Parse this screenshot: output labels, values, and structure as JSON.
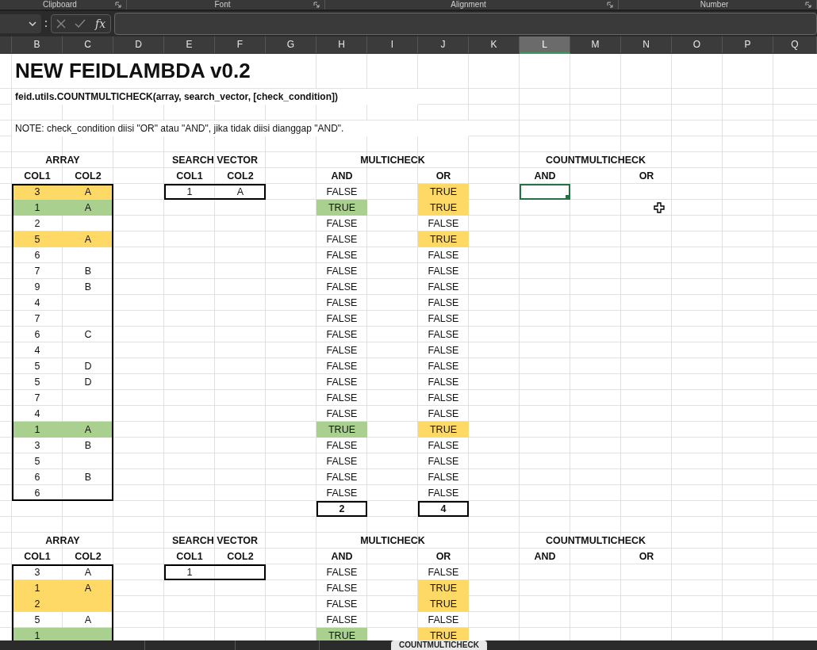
{
  "ribbon_groups": [
    "Clipboard",
    "Font",
    "Alignment",
    "Number"
  ],
  "formula_bar": {
    "function_label": "fx"
  },
  "columns": [
    {
      "letter": "B",
      "selected": false
    },
    {
      "letter": "C",
      "selected": false
    },
    {
      "letter": "D",
      "selected": false
    },
    {
      "letter": "E",
      "selected": false
    },
    {
      "letter": "F",
      "selected": false
    },
    {
      "letter": "G",
      "selected": false
    },
    {
      "letter": "H",
      "selected": false
    },
    {
      "letter": "I",
      "selected": false
    },
    {
      "letter": "J",
      "selected": false
    },
    {
      "letter": "K",
      "selected": false
    },
    {
      "letter": "L",
      "selected": true
    },
    {
      "letter": "M",
      "selected": false
    },
    {
      "letter": "N",
      "selected": false
    },
    {
      "letter": "O",
      "selected": false
    },
    {
      "letter": "P",
      "selected": false
    },
    {
      "letter": "Q",
      "selected": false
    }
  ],
  "title": "NEW FEIDLAMBDA v0.2",
  "signature": "feid.utils.COUNTMULTICHECK(array, search_vector, [check_condition])",
  "note": "NOTE: check_condition diisi \"OR\" atau \"AND\", jika tidak diisi dianggap \"AND\".",
  "blocks": [
    {
      "array": {
        "title": "ARRAY",
        "headers": [
          "COL1",
          "COL2"
        ],
        "rows": [
          {
            "col1": "3",
            "col2": "A",
            "color": "#ffd966"
          },
          {
            "col1": "1",
            "col2": "A",
            "color": "#a9d08e"
          },
          {
            "col1": "2"
          },
          {
            "col1": "5",
            "col2": "A",
            "color": "#ffd966"
          },
          {
            "col1": "6"
          },
          {
            "col1": "7",
            "col2": "B"
          },
          {
            "col1": "9",
            "col2": "B"
          },
          {
            "col1": "4"
          },
          {
            "col1": "7"
          },
          {
            "col1": "6",
            "col2": "C"
          },
          {
            "col1": "4"
          },
          {
            "col1": "5",
            "col2": "D"
          },
          {
            "col1": "5",
            "col2": "D"
          },
          {
            "col1": "7"
          },
          {
            "col1": "4"
          },
          {
            "col1": "1",
            "col2": "A",
            "color": "#a9d08e"
          },
          {
            "col1": "3",
            "col2": "B"
          },
          {
            "col1": "5"
          },
          {
            "col1": "6",
            "col2": "B"
          },
          {
            "col1": "6"
          }
        ]
      },
      "search_vector": {
        "title": "SEARCH VECTOR",
        "headers": [
          "COL1",
          "COL2"
        ],
        "values": [
          "1",
          "A"
        ]
      },
      "multicheck": {
        "title": "MULTICHECK",
        "headers": [
          "AND",
          "OR"
        ],
        "rows": [
          {
            "and": {
              "text": "FALSE",
              "highlighted": false
            },
            "or": {
              "text": "TRUE",
              "highlighted": true
            }
          },
          {
            "and": {
              "text": "TRUE",
              "highlighted": true
            },
            "or": {
              "text": "TRUE",
              "highlighted": true
            }
          },
          {
            "and": {
              "text": "FALSE",
              "highlighted": false
            },
            "or": {
              "text": "FALSE",
              "highlighted": false
            }
          },
          {
            "and": {
              "text": "FALSE",
              "highlighted": false
            },
            "or": {
              "text": "TRUE",
              "highlighted": true
            }
          },
          {
            "and": {
              "text": "FALSE",
              "highlighted": false
            },
            "or": {
              "text": "FALSE",
              "highlighted": false
            }
          },
          {
            "and": {
              "text": "FALSE",
              "highlighted": false
            },
            "or": {
              "text": "FALSE",
              "highlighted": false
            }
          },
          {
            "and": {
              "text": "FALSE",
              "highlighted": false
            },
            "or": {
              "text": "FALSE",
              "highlighted": false
            }
          },
          {
            "and": {
              "text": "FALSE",
              "highlighted": false
            },
            "or": {
              "text": "FALSE",
              "highlighted": false
            }
          },
          {
            "and": {
              "text": "FALSE",
              "highlighted": false
            },
            "or": {
              "text": "FALSE",
              "highlighted": false
            }
          },
          {
            "and": {
              "text": "FALSE",
              "highlighted": false
            },
            "or": {
              "text": "FALSE",
              "highlighted": false
            }
          },
          {
            "and": {
              "text": "FALSE",
              "highlighted": false
            },
            "or": {
              "text": "FALSE",
              "highlighted": false
            }
          },
          {
            "and": {
              "text": "FALSE",
              "highlighted": false
            },
            "or": {
              "text": "FALSE",
              "highlighted": false
            }
          },
          {
            "and": {
              "text": "FALSE",
              "highlighted": false
            },
            "or": {
              "text": "FALSE",
              "highlighted": false
            }
          },
          {
            "and": {
              "text": "FALSE",
              "highlighted": false
            },
            "or": {
              "text": "FALSE",
              "highlighted": false
            }
          },
          {
            "and": {
              "text": "FALSE",
              "highlighted": false
            },
            "or": {
              "text": "FALSE",
              "highlighted": false
            }
          },
          {
            "and": {
              "text": "TRUE",
              "highlighted": true
            },
            "or": {
              "text": "TRUE",
              "highlighted": true
            }
          },
          {
            "and": {
              "text": "FALSE",
              "highlighted": false
            },
            "or": {
              "text": "FALSE",
              "highlighted": false
            }
          },
          {
            "and": {
              "text": "FALSE",
              "highlighted": false
            },
            "or": {
              "text": "FALSE",
              "highlighted": false
            }
          },
          {
            "and": {
              "text": "FALSE",
              "highlighted": false
            },
            "or": {
              "text": "FALSE",
              "highlighted": false
            }
          },
          {
            "and": {
              "text": "FALSE",
              "highlighted": false
            },
            "or": {
              "text": "FALSE",
              "highlighted": false
            }
          }
        ],
        "totals": [
          "2",
          "4"
        ]
      },
      "countmulticheck": {
        "title": "COUNTMULTICHECK",
        "headers": [
          "AND",
          "OR"
        ],
        "active_cell": true
      }
    },
    {
      "array": {
        "title": "ARRAY",
        "headers": [
          "COL1",
          "COL2"
        ],
        "rows": [
          {
            "col1": "3",
            "col2": "A"
          },
          {
            "col1": "1",
            "col2": "A",
            "color": "#ffd966"
          },
          {
            "col1": "2",
            "color": "#ffd966"
          },
          {
            "col1": "5",
            "col2": "A"
          },
          {
            "col1": "1",
            "color": "#a9d08e"
          }
        ]
      },
      "search_vector": {
        "title": "SEARCH VECTOR",
        "headers": [
          "COL1",
          "COL2"
        ],
        "values": [
          "1"
        ]
      },
      "multicheck": {
        "title": "MULTICHECK",
        "headers": [
          "AND",
          "OR"
        ],
        "rows": [
          {
            "and": {
              "text": "FALSE",
              "highlighted": false
            },
            "or": {
              "text": "FALSE",
              "highlighted": false
            }
          },
          {
            "and": {
              "text": "FALSE",
              "highlighted": false
            },
            "or": {
              "text": "TRUE",
              "highlighted": true
            }
          },
          {
            "and": {
              "text": "FALSE",
              "highlighted": false
            },
            "or": {
              "text": "TRUE",
              "highlighted": true
            }
          },
          {
            "and": {
              "text": "FALSE",
              "highlighted": false
            },
            "or": {
              "text": "FALSE",
              "highlighted": false
            }
          },
          {
            "and": {
              "text": "TRUE",
              "highlighted": true
            },
            "or": {
              "text": "TRUE",
              "highlighted": true
            }
          }
        ]
      },
      "countmulticheck": {
        "title": "COUNTMULTICHECK",
        "headers": [
          "AND",
          "OR"
        ]
      }
    }
  ],
  "sheet_tabs": [
    {
      "label": "COUNTMULTICHECK",
      "selected": true
    }
  ]
}
